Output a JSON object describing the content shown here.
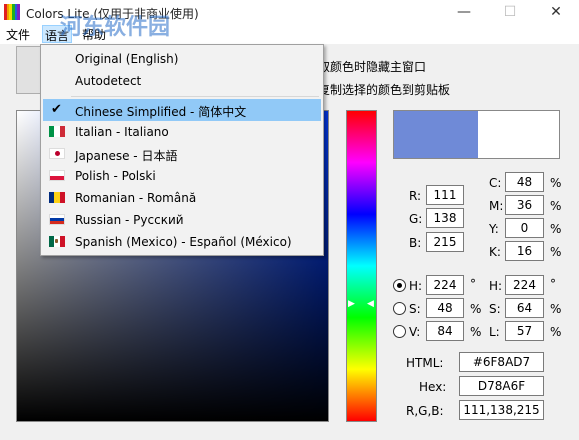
{
  "window": {
    "title": "Colors Lite (仅用于非商业使用)",
    "minimize_glyph": "—",
    "maximize_glyph": "☐",
    "close_glyph": "✕"
  },
  "watermark": {
    "title": "河东软件园",
    "url": "www.pc0359.cn"
  },
  "menubar": {
    "file": "文件",
    "language": "语言",
    "help": "帮助"
  },
  "options": {
    "hide_on_pick": "取颜色时隐藏主窗口",
    "copy_to_clipboard": "复制选择的颜色到剪贴板"
  },
  "language_menu": {
    "items": [
      {
        "label": "Original (English)",
        "icon": "none",
        "checked": false
      },
      {
        "label": "Autodetect",
        "icon": "none",
        "checked": false
      },
      {
        "label": "Chinese Simplified - 简体中文",
        "icon": "checkmark-icon",
        "checked": true
      },
      {
        "label": "Italian - Italiano",
        "icon": "flag-italy-icon",
        "checked": false
      },
      {
        "label": "Japanese - 日本語",
        "icon": "flag-japan-icon",
        "checked": false
      },
      {
        "label": "Polish - Polski",
        "icon": "flag-poland-icon",
        "checked": false
      },
      {
        "label": "Romanian - Română",
        "icon": "flag-romania-icon",
        "checked": false
      },
      {
        "label": "Russian - Русский",
        "icon": "flag-russia-icon",
        "checked": false
      },
      {
        "label": "Spanish (Mexico) - Español (México)",
        "icon": "flag-mexico-icon",
        "checked": false
      }
    ]
  },
  "color": {
    "hex_value": "#6F8AD7",
    "accent": "#6F8AD7"
  },
  "rgb": {
    "r_label": "R:",
    "r": "111",
    "g_label": "G:",
    "g": "138",
    "b_label": "B:",
    "b": "215"
  },
  "cmyk": {
    "c_label": "C:",
    "c": "48",
    "m_label": "M:",
    "m": "36",
    "y_label": "Y:",
    "y": "0",
    "k_label": "K:",
    "k": "16",
    "unit": "%"
  },
  "hsv": {
    "h_label": "H:",
    "h": "224",
    "h_unit": "°",
    "s_label": "S:",
    "s": "48",
    "s_unit": "%",
    "v_label": "V:",
    "v": "84",
    "v_unit": "%",
    "selected": "H"
  },
  "hsl": {
    "h_label": "H:",
    "h": "224",
    "h_unit": "°",
    "s_label": "S:",
    "s": "64",
    "s_unit": "%",
    "l_label": "L:",
    "l": "57",
    "l_unit": "%"
  },
  "codes": {
    "html_label": "HTML:",
    "html": "#6F8AD7",
    "hex_label": "Hex:",
    "hex": "D78A6F",
    "rgb_label": "R,G,B:",
    "rgb": "111,138,215"
  }
}
